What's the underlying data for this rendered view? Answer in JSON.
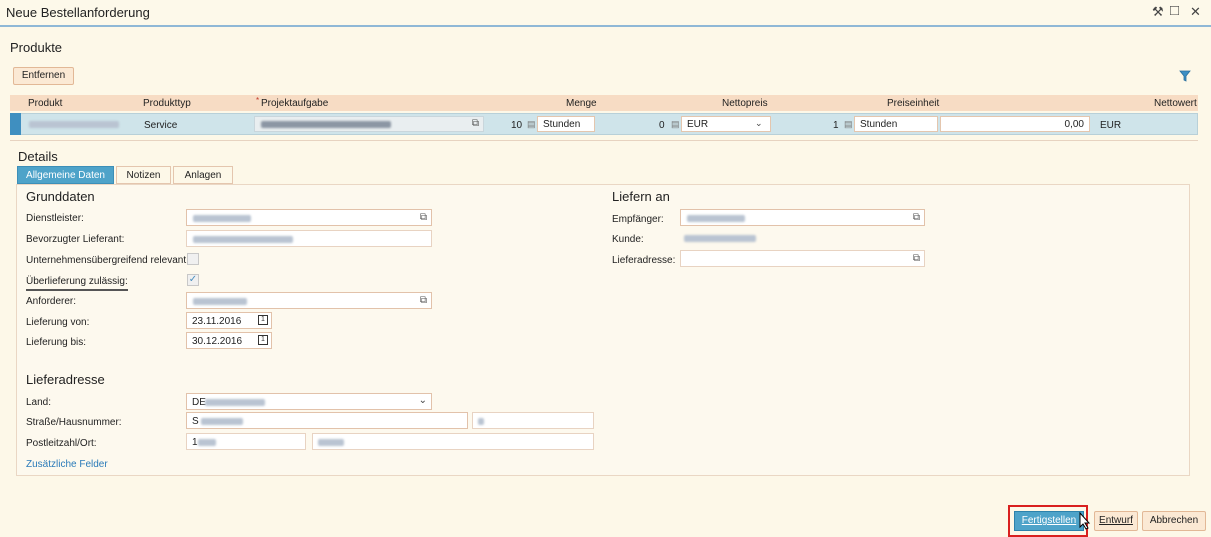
{
  "window": {
    "title": "Neue Bestellanforderung",
    "wrench_glyph": "⚒",
    "maximize_glyph": "□",
    "close_glyph": "✕"
  },
  "products": {
    "section_title": "Produkte",
    "remove_button": "Entfernen",
    "columns": [
      "Produkt",
      "Produkttyp",
      "Projektaufgabe",
      "Menge",
      "Nettopreis",
      "Preiseinheit",
      "Nettowert"
    ],
    "required_marker": "*",
    "row": {
      "product_type": "Service",
      "quantity": "10",
      "quantity_unit": "Stunden",
      "net_price": "0",
      "currency": "EUR",
      "price_unit": "1",
      "price_unit_uom": "Stunden",
      "net_value": "0,00",
      "net_value_currency": "EUR"
    }
  },
  "details": {
    "section_title": "Details",
    "tabs": [
      "Allgemeine Daten",
      "Notizen",
      "Anlagen"
    ],
    "grunddaten": {
      "title": "Grunddaten",
      "labels": {
        "dienstleister": "Dienstleister:",
        "lieferant": "Bevorzugter Lieferant:",
        "unternehmen": "Unternehmensübergreifend relevant:",
        "ueberlieferung": "Überlieferung zulässig:",
        "anforderer": "Anforderer:",
        "lieferung_von": "Lieferung von:",
        "lieferung_bis": "Lieferung bis:"
      },
      "values": {
        "lieferung_von": "23.11.2016",
        "lieferung_bis": "30.12.2016"
      },
      "check_glyph": "✓"
    },
    "liefern_an": {
      "title": "Liefern an",
      "labels": {
        "empfaenger": "Empfänger:",
        "kunde": "Kunde:",
        "lieferadresse": "Lieferadresse:"
      }
    },
    "lieferadresse": {
      "title": "Lieferadresse",
      "labels": {
        "land": "Land:",
        "strasse": "Straße/Hausnummer:",
        "plz": "Postleitzahl/Ort:"
      },
      "values": {
        "land": "DE",
        "strasse": "S",
        "plz": "1"
      },
      "more_link": "Zusätzliche Felder"
    }
  },
  "footer": {
    "finish": "Fertigstellen",
    "draft": "Entwurf",
    "cancel": "Abbrechen"
  }
}
